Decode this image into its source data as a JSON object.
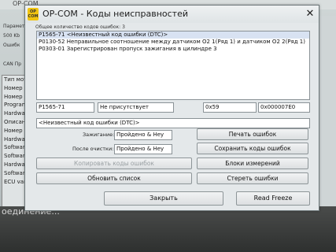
{
  "background": {
    "window_title": "OP-COM",
    "top_labels": [
      "Параметр",
      "500 Kb",
      "Ошибк",
      "",
      "CAN Пр"
    ],
    "side_list": [
      "Тип мот",
      "Номер",
      "Номер",
      "Program",
      "Hardwar",
      "Описан",
      "Номер",
      "Hardwar",
      "Software",
      "Software",
      "Hardware",
      "Software",
      "ECU var"
    ],
    "bottom_text": "оединение..."
  },
  "dialog": {
    "logo_line1": "OP",
    "logo_line2": "COM",
    "title": "OP-COM - Коды неисправностей",
    "close_glyph": "✕",
    "code_count_label": "Общее количество кодов ошибок: 3",
    "codes": [
      "P1565-71 <Неизвестный код ошибки (DTC)>",
      "P0130-52 Неправильное соотношение между датчиком O2 1(Ряд 1) и датчиком O2  2(Ряд 1)",
      "P0303-01 Зарегистрирован пропуск зажигания в цилиндре 3"
    ],
    "detail": {
      "code": "P1565-71",
      "status": "Не присутствует",
      "hex1": "0x59",
      "hex2": "0x000007E0",
      "description": "<Неизвестный код ошибки (DTC)>"
    },
    "ignition_label": "Зажигание:",
    "ignition_value": "Пройдено & Неу",
    "after_clear_label": "После очистки:",
    "after_clear_value": "Пройдено & Неу",
    "buttons": {
      "print_errors": "Печать ошибок",
      "save_codes": "Сохранить коды ошибок",
      "copy_codes": "Копировать коды ошибок",
      "measurement_blocks": "Блоки измерений",
      "refresh_list": "Обновить список",
      "clear_errors": "Стереть ошибки",
      "close": "Закрыть",
      "read_freeze": "Read Freeze"
    }
  }
}
